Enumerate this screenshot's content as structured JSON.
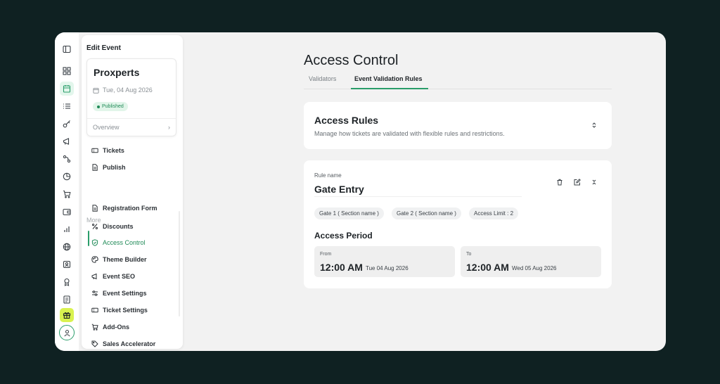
{
  "panel": {
    "title": "Edit Event",
    "event": {
      "name": "Proxperts",
      "date": "Tue, 04 Aug 2026",
      "status": "Published",
      "overview_label": "Overview",
      "overview_chevron": "›"
    },
    "items_top": [
      {
        "label": "Tickets",
        "icon": "ticket-icon"
      },
      {
        "label": "Publish",
        "icon": "document-icon"
      }
    ],
    "section_label": "More",
    "items_more": [
      {
        "label": "Registration Form",
        "icon": "form-icon"
      },
      {
        "label": "Discounts",
        "icon": "percent-icon"
      },
      {
        "label": "Access Control",
        "icon": "shield-icon",
        "active": true
      },
      {
        "label": "Theme Builder",
        "icon": "palette-icon"
      },
      {
        "label": "Event SEO",
        "icon": "megaphone-icon"
      },
      {
        "label": "Event Settings",
        "icon": "settings-sliders-icon"
      },
      {
        "label": "Ticket Settings",
        "icon": "ticket-settings-icon"
      },
      {
        "label": "Add-Ons",
        "icon": "cart-icon"
      },
      {
        "label": "Sales Accelerator",
        "icon": "tag-icon"
      }
    ]
  },
  "main": {
    "title": "Access Control",
    "tabs": [
      {
        "label": "Validators",
        "active": false
      },
      {
        "label": "Event Validation Rules",
        "active": true
      }
    ],
    "access_rules": {
      "title": "Access Rules",
      "description": "Manage how tickets are validated with flexible rules and restrictions."
    },
    "rule": {
      "name_label": "Rule name",
      "name": "Gate Entry",
      "chips": [
        "Gate 1 ( Section name )",
        "Gate 2 ( Section name )",
        "Access Limit : 2"
      ],
      "period_title": "Access Period",
      "from": {
        "label": "From",
        "time": "12:00 AM",
        "date": "Tue 04 Aug 2026"
      },
      "to": {
        "label": "To",
        "time": "12:00 AM",
        "date": "Wed 05 Aug 2026"
      }
    }
  },
  "colors": {
    "accent": "#2a9d6a",
    "background": "#0f2122",
    "highlight": "#d9f24f"
  }
}
